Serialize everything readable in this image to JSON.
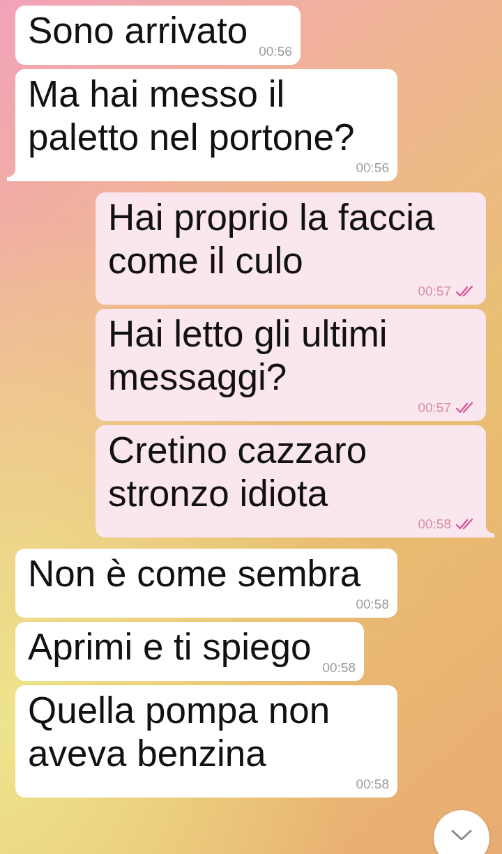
{
  "messages": [
    {
      "kind": "incoming",
      "text": "Sono arrivato",
      "time": "00:56",
      "tail": false
    },
    {
      "kind": "incoming",
      "text": "Ma hai messo il paletto nel portone?",
      "time": "00:56",
      "tail": true
    },
    {
      "kind": "outgoing",
      "text": "Hai proprio la faccia come il culo",
      "time": "00:57",
      "tail": false,
      "read": true
    },
    {
      "kind": "outgoing",
      "text": "Hai letto gli ultimi messaggi?",
      "time": "00:57",
      "tail": false,
      "read": true
    },
    {
      "kind": "outgoing",
      "text": "Cretino cazzaro stronzo idiota",
      "time": "00:58",
      "tail": true,
      "read": true
    },
    {
      "kind": "incoming",
      "text": "Non è come sembra",
      "time": "00:58",
      "tail": false
    },
    {
      "kind": "incoming",
      "text": "Aprimi e ti spiego",
      "time": "00:58",
      "tail": false
    },
    {
      "kind": "incoming",
      "text": "Quella pompa non aveva benzina",
      "time": "00:58"
    }
  ]
}
